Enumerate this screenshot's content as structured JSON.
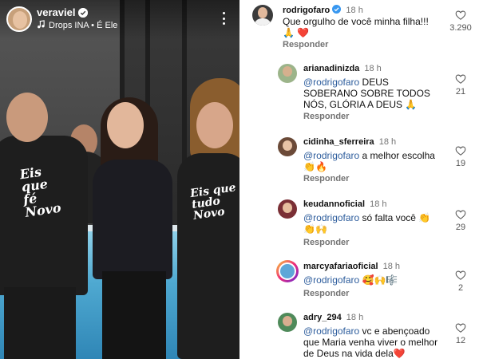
{
  "story": {
    "username": "veraviel",
    "audio": "Drops INA • É Ele",
    "shirt_text_1": "Eis\nque\nfé\nNovo",
    "shirt_text_2": "Eis que\ntudo\nNovo"
  },
  "comments": [
    {
      "username": "rodrigofaro",
      "verified": true,
      "time": "18 h",
      "mention": "",
      "text": "Que orgulho de você minha filha!!! 🙏 ❤️",
      "reply_label": "Responder",
      "likes": "3.290"
    },
    {
      "username": "arianadinizda",
      "verified": false,
      "time": "18 h",
      "mention": "@rodrigofaro",
      "text": " DEUS SOBERANO SOBRE TODOS NÓS, GLÓRIA A DEUS 🙏",
      "reply_label": "Responder",
      "likes": "21"
    },
    {
      "username": "cidinha_sferreira",
      "verified": false,
      "time": "18 h",
      "mention": "@rodrigofaro",
      "text": " a melhor escolha 👏🔥",
      "reply_label": "Responder",
      "likes": "19"
    },
    {
      "username": "keudannoficial",
      "verified": false,
      "time": "18 h",
      "mention": "@rodrigofaro",
      "text": " só falta você 👏 👏🙌",
      "reply_label": "Responder",
      "likes": "29"
    },
    {
      "username": "marcyafariaoficial",
      "verified": false,
      "time": "18 h",
      "mention": "@rodrigofaro",
      "text": " 🥰🙌🎼",
      "reply_label": "Responder",
      "likes": "2"
    },
    {
      "username": "adry_294",
      "verified": false,
      "time": "18 h",
      "mention": "@rodrigofaro",
      "text": " vc e abençoado que Maria venha viver o melhor de Deus na vida dela❤️",
      "reply_label": "",
      "likes": "12"
    }
  ],
  "colors": {
    "mention": "#2c5c9c",
    "verified": "#3897f0",
    "muted": "#737373"
  },
  "icons": {
    "verified": "verified-badge-icon",
    "music": "music-note-icon",
    "more": "more-vertical-icon",
    "like": "heart-outline-icon"
  }
}
